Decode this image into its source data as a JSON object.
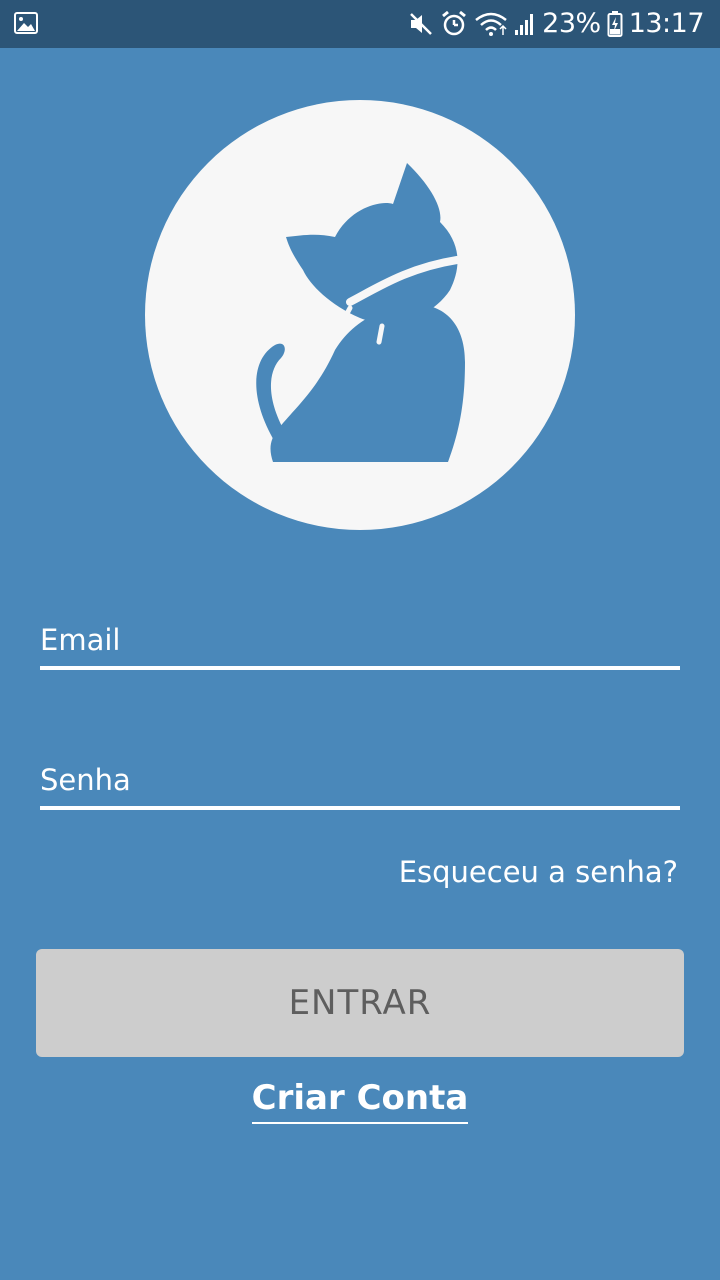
{
  "status_bar": {
    "battery": "23%",
    "time": "13:17",
    "icons": [
      "gallery-icon",
      "mute-icon",
      "alarm-icon",
      "wifi-icon",
      "signal-icon",
      "battery-icon"
    ]
  },
  "logo": {
    "icon": "cat-with-collar-icon"
  },
  "form": {
    "email_placeholder": "Email",
    "password_placeholder": "Senha",
    "forgot_label": "Esqueceu a senha?",
    "login_label": "ENTRAR",
    "create_account_label": "Criar Conta"
  },
  "colors": {
    "background": "#4a88ba",
    "status_bar": "#2c5577",
    "logo_circle": "#f7f7f7",
    "button": "#cdcdcd",
    "button_text": "#5e5e5e"
  }
}
